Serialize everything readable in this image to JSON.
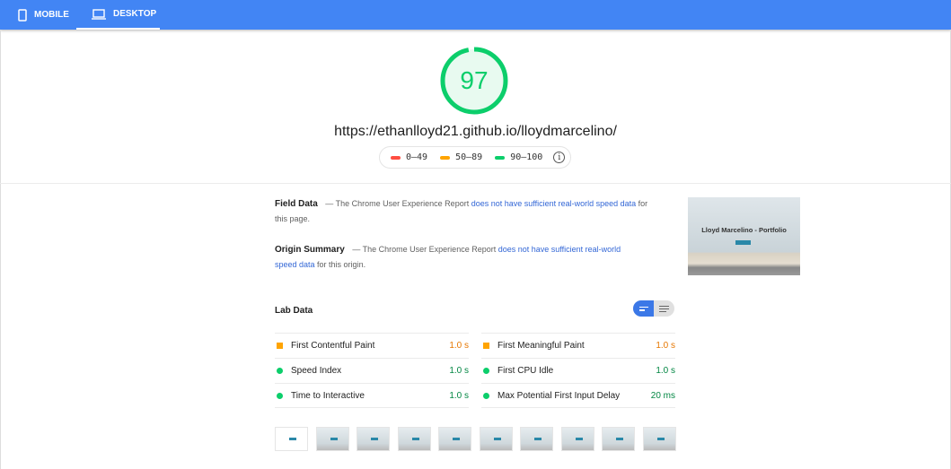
{
  "tabs": [
    {
      "label": "MOBILE",
      "icon": "phone-icon"
    },
    {
      "label": "DESKTOP",
      "icon": "laptop-icon",
      "active": true
    }
  ],
  "score": {
    "value": "97",
    "fraction": 0.97,
    "color": "#0cce6b"
  },
  "url": "https://ethanlloyd21.github.io/lloydmarcelino/",
  "legend": [
    {
      "label": "0–49",
      "color": "#ff4e42"
    },
    {
      "label": "50–89",
      "color": "#ffa400"
    },
    {
      "label": "90–100",
      "color": "#0cce6b"
    }
  ],
  "field_data": {
    "title": "Field Data",
    "pre": " — The Chrome User Experience Report ",
    "link": "does not have sufficient real-world speed data",
    "post": " for this page."
  },
  "origin_summary": {
    "title": "Origin Summary",
    "pre": " — The Chrome User Experience Report ",
    "link": "does not have sufficient real-world speed data",
    "post": " for this origin."
  },
  "screenshot": {
    "title": "Lloyd Marcelino - Portfolio"
  },
  "lab": {
    "title": "Lab Data",
    "metrics": [
      {
        "label": "First Contentful Paint",
        "value": "1.0 s",
        "status": "average"
      },
      {
        "label": "First Meaningful Paint",
        "value": "1.0 s",
        "status": "average"
      },
      {
        "label": "Speed Index",
        "value": "1.0 s",
        "status": "pass"
      },
      {
        "label": "First CPU Idle",
        "value": "1.0 s",
        "status": "pass"
      },
      {
        "label": "Time to Interactive",
        "value": "1.0 s",
        "status": "pass"
      },
      {
        "label": "Max Potential First Input Delay",
        "value": "20 ms",
        "status": "pass"
      }
    ]
  },
  "colors": {
    "header": "#4285f4",
    "average": "#ffa400",
    "average_text": "#e67700",
    "pass": "#0cce6b",
    "pass_text": "#018642",
    "link": "#3367d6"
  },
  "filmstrip_frames": 10
}
